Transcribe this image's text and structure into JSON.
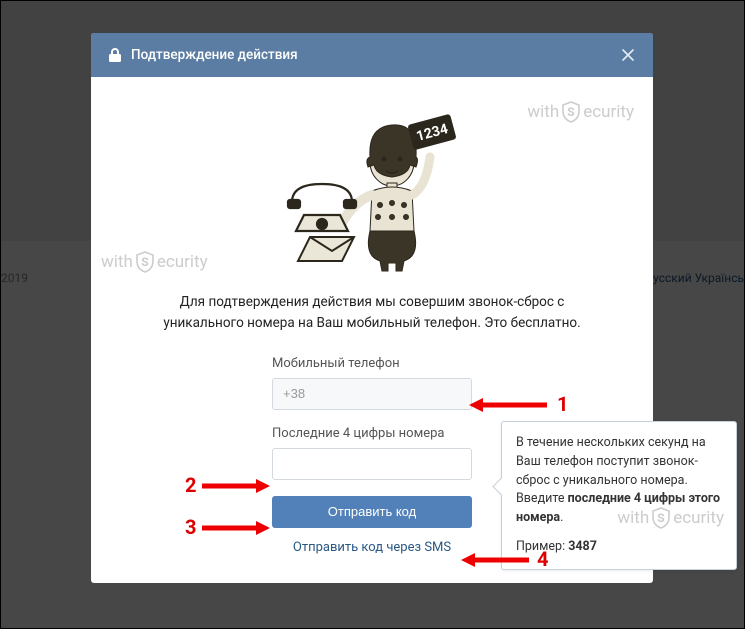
{
  "bg": {
    "year": "2019",
    "langs": "усский   Українсь"
  },
  "header": {
    "title": "Подтверждение действия"
  },
  "illustration": {
    "code_card": "1234"
  },
  "description": "Для подтверждения действия мы совершим звонок-сброс с уникального номера на Ваш мобильный телефон. Это бесплатно.",
  "form": {
    "phone_label": "Мобильный телефон",
    "phone_value": "+38",
    "code_label": "Последние 4 цифры номера",
    "code_value": "",
    "submit_label": "Отправить код",
    "sms_link": "Отправить код через SMS"
  },
  "tooltip": {
    "text_pre": "В течение нескольких секунд на Ваш телефон поступит звонок-сброс с уникального номера. Введите ",
    "text_bold": "последние 4 цифры этого номера",
    "example_label": "Пример: ",
    "example_value": "3487"
  },
  "watermark": {
    "prefix": "with",
    "suffix": "ecurity"
  },
  "annotations": {
    "n1": "1",
    "n2": "2",
    "n3": "3",
    "n4": "4"
  }
}
